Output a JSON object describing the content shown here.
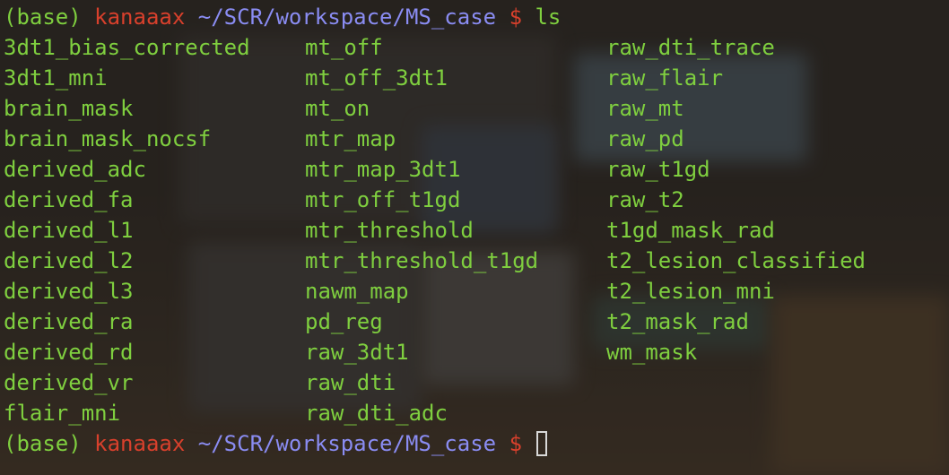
{
  "prompt": {
    "env": "(base)",
    "user": "kanaaax",
    "path": "~/SCR/workspace/MS_case",
    "symbol": "$",
    "command": "ls"
  },
  "listing": {
    "columns": [
      [
        "3dt1_bias_corrected",
        "3dt1_mni",
        "brain_mask",
        "brain_mask_nocsf",
        "derived_adc",
        "derived_fa",
        "derived_l1",
        "derived_l2",
        "derived_l3",
        "derived_ra",
        "derived_rd",
        "derived_vr",
        "flair_mni"
      ],
      [
        "mt_off",
        "mt_off_3dt1",
        "mt_on",
        "mtr_map",
        "mtr_map_3dt1",
        "mtr_off_t1gd",
        "mtr_threshold",
        "mtr_threshold_t1gd",
        "nawm_map",
        "pd_reg",
        "raw_3dt1",
        "raw_dti",
        "raw_dti_adc"
      ],
      [
        "raw_dti_trace",
        "raw_flair",
        "raw_mt",
        "raw_pd",
        "raw_t1gd",
        "raw_t2",
        "t1gd_mask_rad",
        "t2_lesion_classified",
        "t2_lesion_mni",
        "t2_mask_rad",
        "wm_mask"
      ]
    ]
  },
  "colors": {
    "env": "#7fcf3f",
    "user": "#d8402c",
    "path": "#8a8cf2",
    "entries": "#7fcf3f"
  }
}
